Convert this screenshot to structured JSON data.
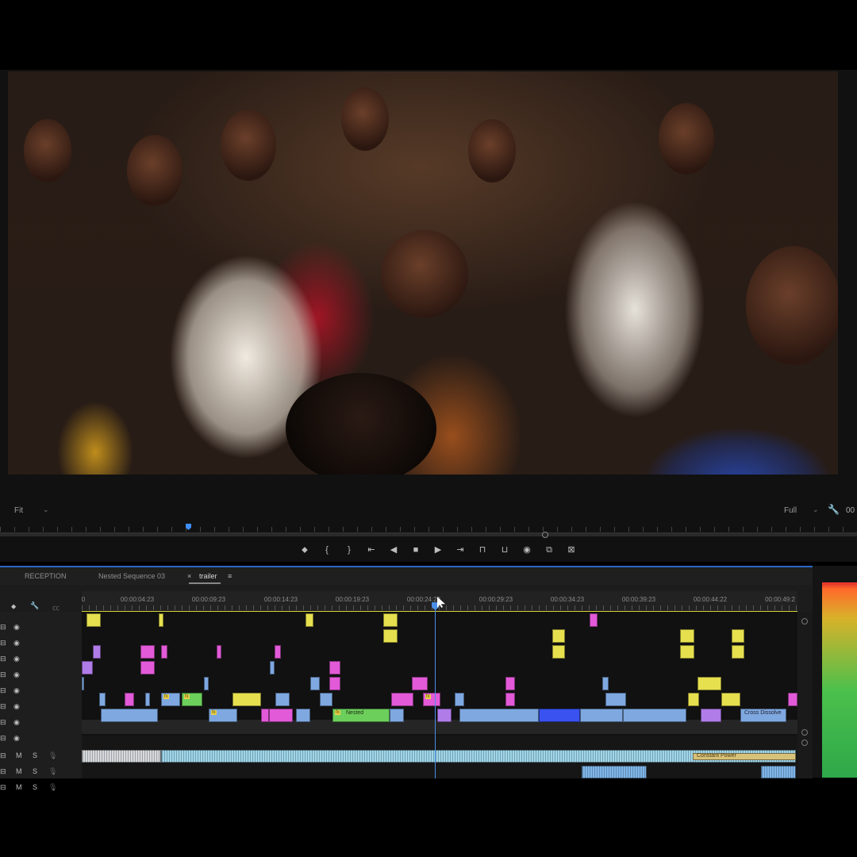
{
  "monitor": {
    "fit_label": "Fit",
    "full_label": "Full",
    "timecode_stub": "00"
  },
  "transport_buttons": [
    "marker-icon",
    "mark-in-icon",
    "mark-out-icon",
    "go-to-in-icon",
    "step-back-icon",
    "stop-icon",
    "play-icon",
    "go-to-out-icon",
    "lift-icon",
    "extract-icon",
    "export-frame-icon",
    "insert-icon",
    "overwrite-icon"
  ],
  "timeline": {
    "tabs": [
      {
        "label": "RECEPTION"
      },
      {
        "label": "Nested Sequence 03"
      },
      {
        "label": "trailer",
        "close": "×",
        "menu": "≡"
      }
    ],
    "ruler_start": "0",
    "ruler_labels": [
      "00:00:04:23",
      "00:00:09:23",
      "00:00:14:23",
      "00:00:19:23",
      "00:00:24:23",
      "00:00:29:23",
      "00:00:34:23",
      "00:00:39:23",
      "00:00:44:22",
      "00:00:49:2"
    ],
    "video_tracks": 8,
    "audio_tracks": 3,
    "audio_toggles": {
      "mute": "M",
      "solo": "S"
    },
    "clip_labels": {
      "nested": "Nested",
      "cross_dissolve": "Cross Dissolve",
      "constant_power": "Constant Power"
    },
    "fx_badge": "fx"
  },
  "colors": {
    "yellow_clip": "#e6e04f",
    "magenta_clip": "#e25ad8",
    "violet_clip": "#b07ce8",
    "blue_clip": "#7fa8e0",
    "green_clip": "#6ccf5c",
    "audio_clip": "#9fd6e8",
    "playhead": "#4a8fe7"
  }
}
